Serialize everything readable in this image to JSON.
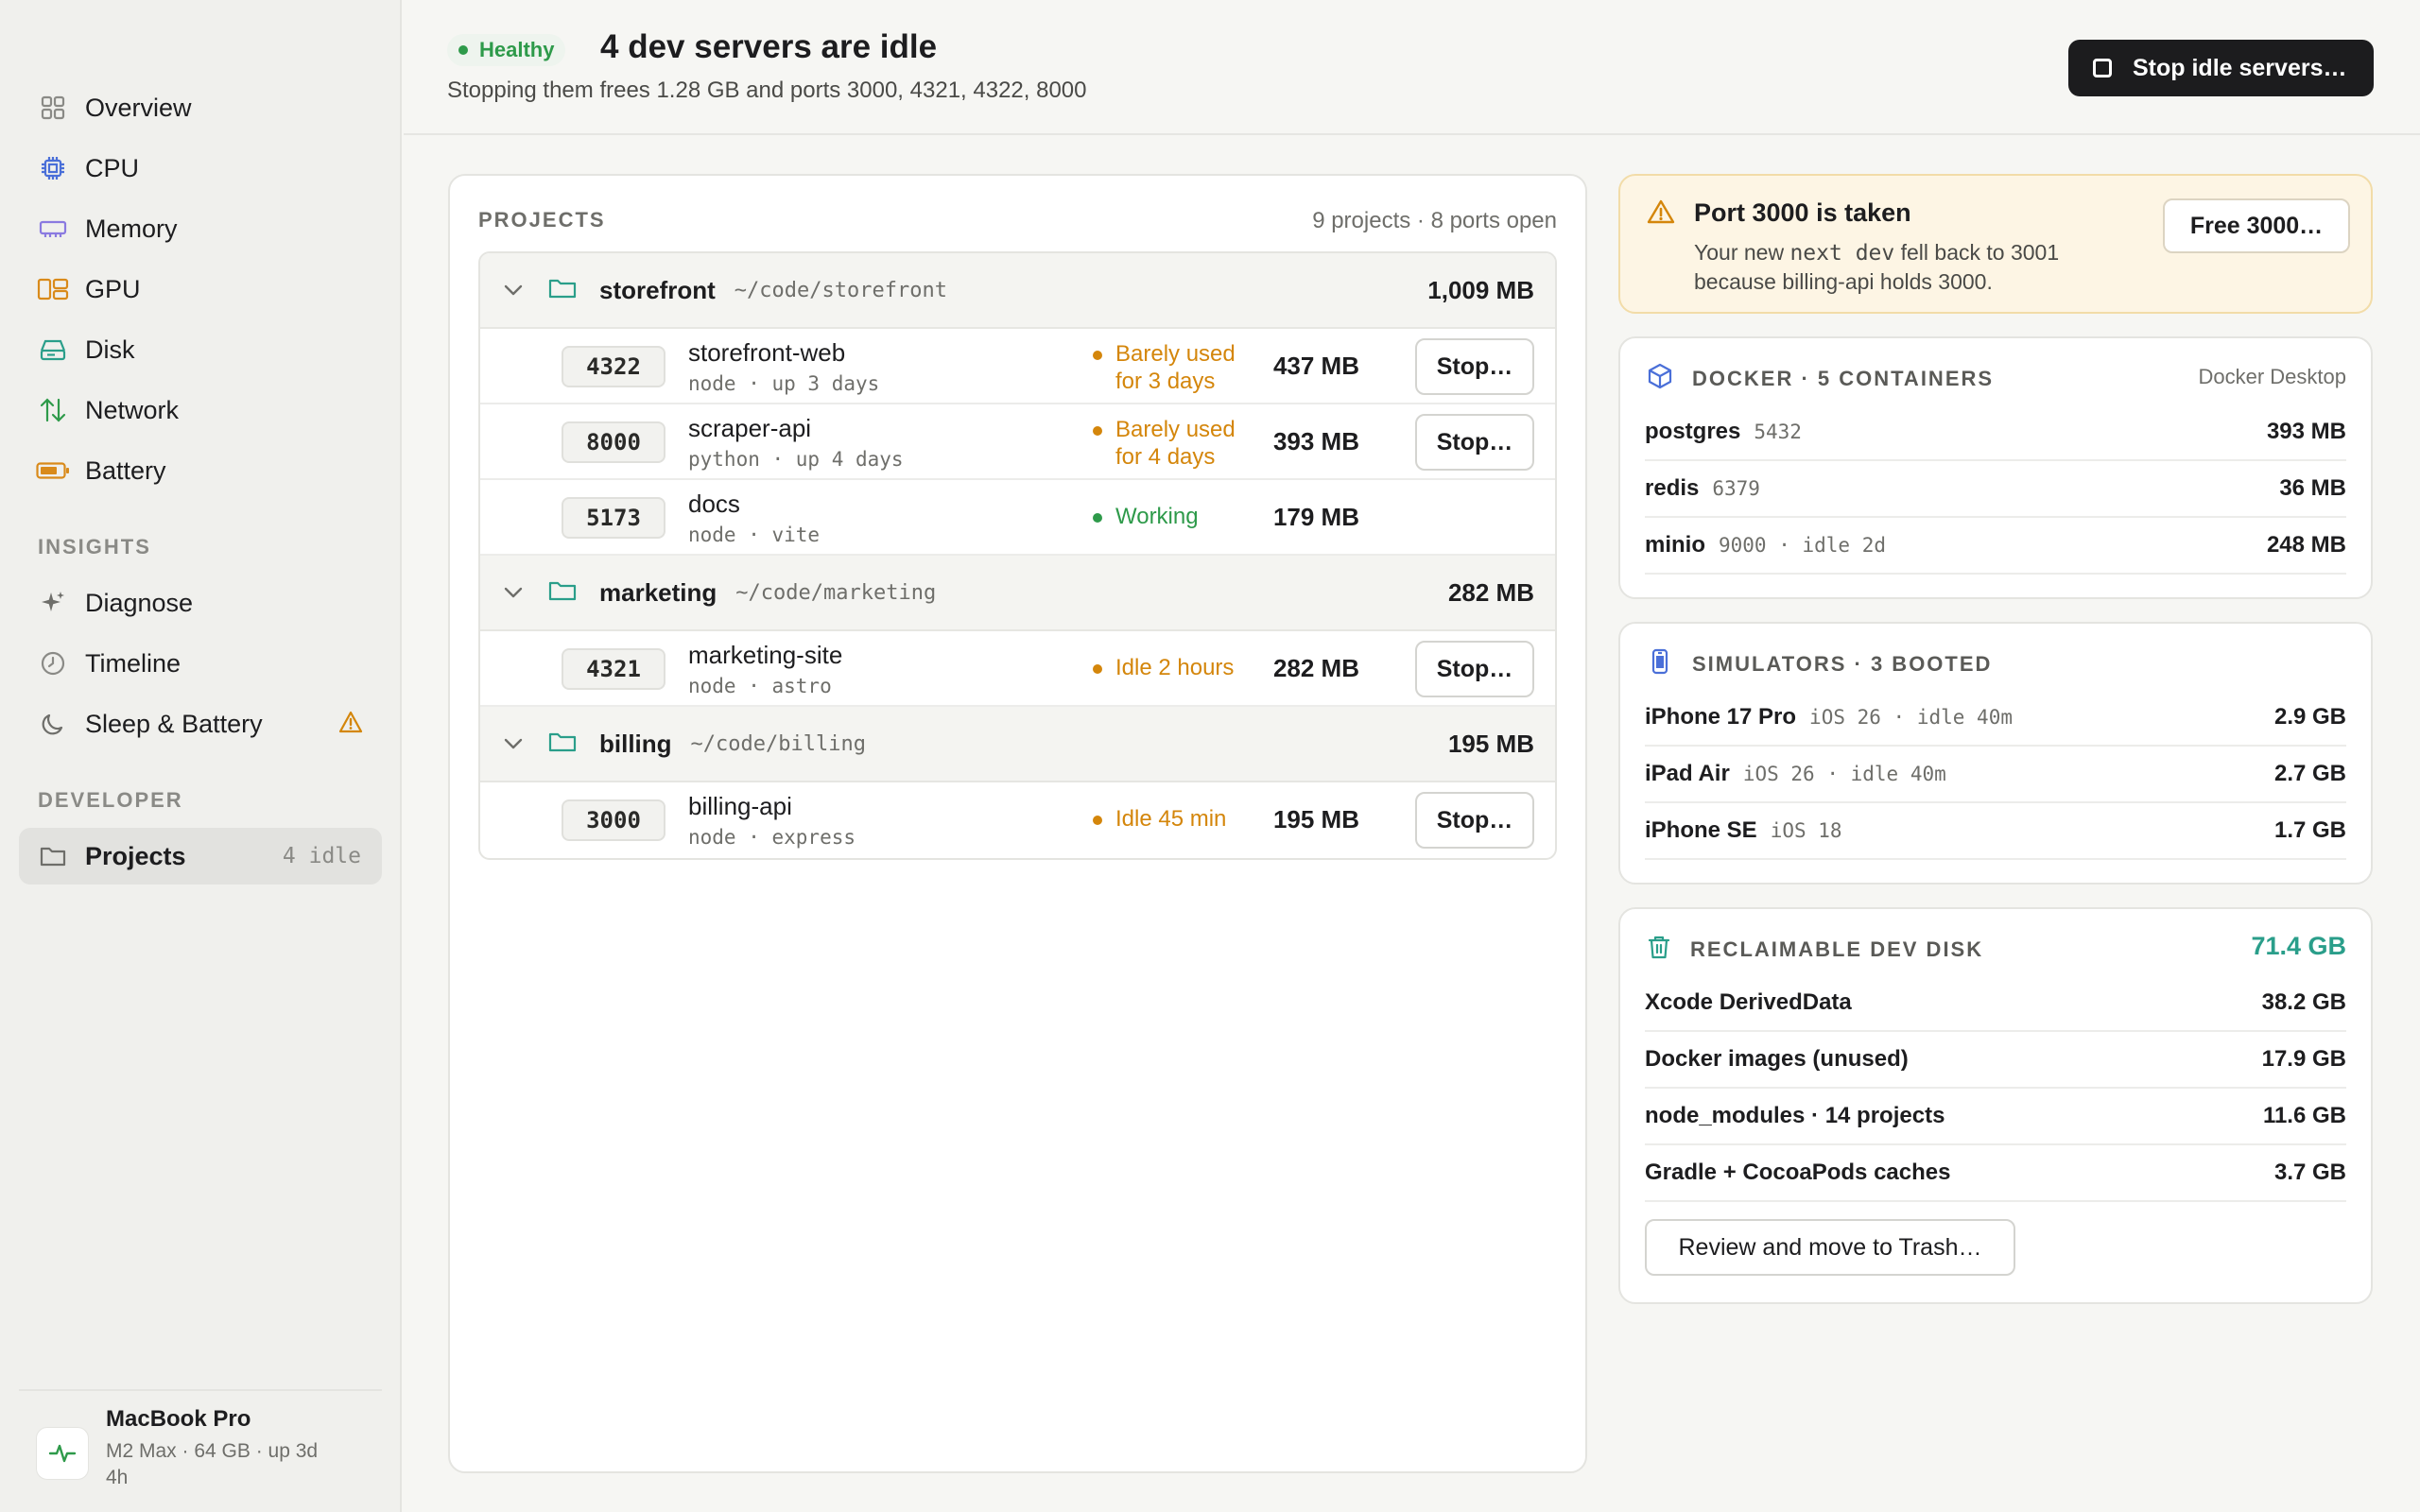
{
  "sidebar": {
    "items": [
      {
        "label": "Overview",
        "icon": "grid-icon"
      },
      {
        "label": "CPU",
        "icon": "cpu-icon"
      },
      {
        "label": "Memory",
        "icon": "memory-icon"
      },
      {
        "label": "GPU",
        "icon": "gpu-icon"
      },
      {
        "label": "Disk",
        "icon": "disk-icon"
      },
      {
        "label": "Network",
        "icon": "network-icon"
      },
      {
        "label": "Battery",
        "icon": "battery-icon"
      }
    ],
    "insights_heading": "INSIGHTS",
    "insights": [
      {
        "label": "Diagnose",
        "icon": "sparkle-icon"
      },
      {
        "label": "Timeline",
        "icon": "clock-icon"
      },
      {
        "label": "Sleep & Battery",
        "icon": "moon-icon"
      }
    ],
    "developer_heading": "DEVELOPER",
    "developer": [
      {
        "label": "Projects",
        "badge": "4 idle",
        "icon": "folder-icon"
      }
    ],
    "device": {
      "name": "MacBook Pro",
      "details": "M2 Max · 64 GB · up 3d 4h"
    }
  },
  "header": {
    "status": "Healthy",
    "title": "4 dev servers are idle",
    "subtitle": "Stopping them frees 1.28 GB and ports 3000, 4321, 4322, 8000",
    "stop_all_label": "Stop idle servers…"
  },
  "projects": {
    "heading": "PROJECTS",
    "count": "9 projects · 8 ports open",
    "groups": [
      {
        "name": "storefront",
        "path": "~/code/storefront",
        "memory": "1,009 MB",
        "servers": [
          {
            "port": "4322",
            "name": "storefront-web",
            "meta": "node · up 3 days",
            "status": "Barely used for 3 days",
            "memory": "437 MB",
            "action": "Stop…"
          },
          {
            "port": "8000",
            "name": "scraper-api",
            "meta": "python · up 4 days",
            "status": "Barely used for 4 days",
            "memory": "393 MB",
            "action": "Stop…"
          },
          {
            "port": "5173",
            "name": "docs",
            "meta": "node · vite",
            "status": "Working",
            "memory": "179 MB"
          }
        ]
      },
      {
        "name": "marketing",
        "path": "~/code/marketing",
        "memory": "282 MB",
        "servers": [
          {
            "port": "4321",
            "name": "marketing-site",
            "meta": "node · astro",
            "status": "Idle 2 hours",
            "memory": "282 MB",
            "action": "Stop…"
          }
        ]
      },
      {
        "name": "billing",
        "path": "~/code/billing",
        "memory": "195 MB",
        "servers": [
          {
            "port": "3000",
            "name": "billing-api",
            "meta": "node · express",
            "status": "Idle 45 min",
            "memory": "195 MB",
            "action": "Stop…"
          }
        ]
      }
    ]
  },
  "alert": {
    "title": "Port 3000 is taken",
    "body_prefix": "Your new ",
    "body_code": "next dev",
    "body_suffix": " fell back to 3001 because billing-api holds 3000.",
    "action": "Free 3000…"
  },
  "docker": {
    "title": "DOCKER · 5 CONTAINERS",
    "source": "Docker Desktop",
    "rows": [
      {
        "name": "postgres",
        "meta": "5432",
        "value": "393 MB"
      },
      {
        "name": "redis",
        "meta": "6379",
        "value": "36 MB"
      },
      {
        "name": "minio",
        "meta": "9000 · idle 2d",
        "value": "248 MB"
      }
    ]
  },
  "simulators": {
    "title": "SIMULATORS · 3 BOOTED",
    "rows": [
      {
        "name": "iPhone 17 Pro",
        "meta": "iOS 26 · idle 40m",
        "value": "2.9 GB"
      },
      {
        "name": "iPad Air",
        "meta": "iOS 26 · idle 40m",
        "value": "2.7 GB"
      },
      {
        "name": "iPhone SE",
        "meta": "iOS 18",
        "value": "1.7 GB"
      }
    ]
  },
  "reclaim": {
    "title": "RECLAIMABLE DEV DISK",
    "total": "71.4 GB",
    "rows": [
      {
        "name": "Xcode DerivedData",
        "value": "38.2 GB"
      },
      {
        "name": "Docker images (unused)",
        "value": "17.9 GB"
      },
      {
        "name": "node_modules · 14 projects",
        "value": "11.6 GB"
      },
      {
        "name": "Gradle + CocoaPods caches",
        "value": "3.7 GB"
      }
    ],
    "action": "Review and move to Trash…"
  },
  "colors": {
    "accent_idle": "#d4860b",
    "accent_ok": "#2e9a4a",
    "accent_teal": "#2a9e8a"
  }
}
